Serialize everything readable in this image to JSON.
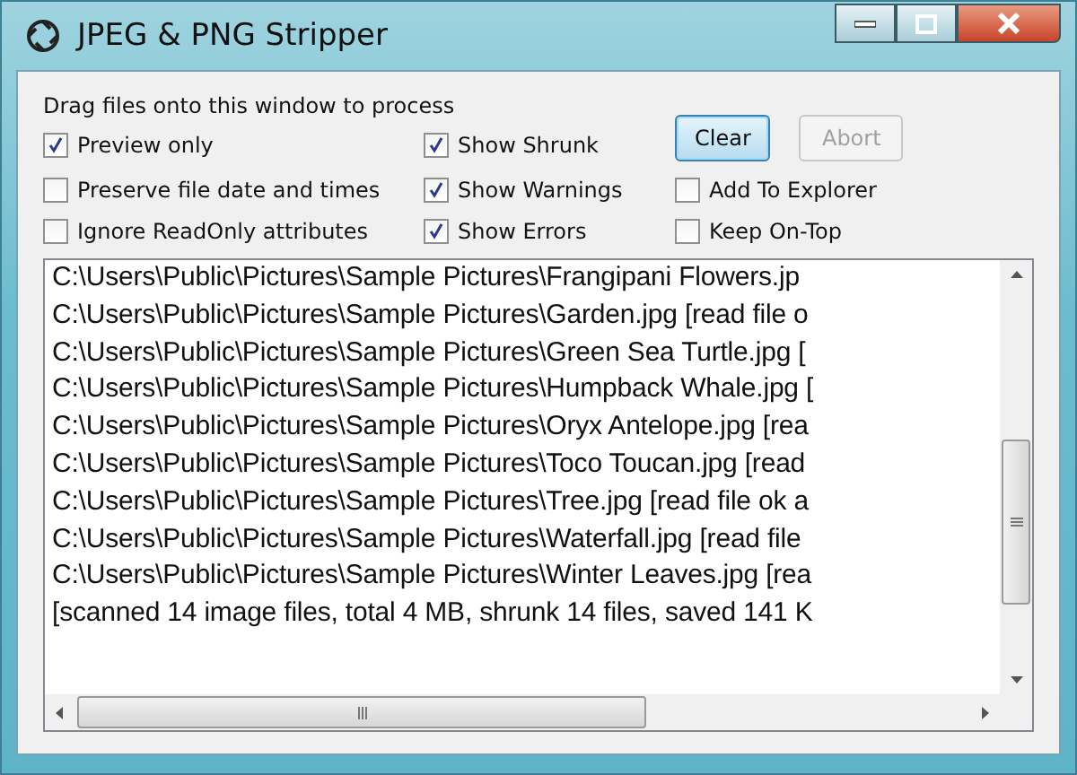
{
  "window": {
    "title": "JPEG & PNG Stripper"
  },
  "instruction": "Drag files onto this window to process",
  "options": [
    {
      "label": "Preview only",
      "checked": true
    },
    {
      "label": "Show Shrunk",
      "checked": true
    },
    {
      "label": "Preserve file date and times",
      "checked": false
    },
    {
      "label": "Show Warnings",
      "checked": true
    },
    {
      "label": "Add To Explorer",
      "checked": false
    },
    {
      "label": "Ignore ReadOnly attributes",
      "checked": false
    },
    {
      "label": "Show Errors",
      "checked": true
    },
    {
      "label": "Keep On-Top",
      "checked": false
    }
  ],
  "buttons": [
    {
      "label": "Clear",
      "disabled": false
    },
    {
      "label": "Abort",
      "disabled": true
    }
  ],
  "log": [
    "C:\\Users\\Public\\Pictures\\Sample Pictures\\Frangipani Flowers.jp",
    "C:\\Users\\Public\\Pictures\\Sample Pictures\\Garden.jpg [read file o",
    "C:\\Users\\Public\\Pictures\\Sample Pictures\\Green Sea Turtle.jpg [",
    "C:\\Users\\Public\\Pictures\\Sample Pictures\\Humpback Whale.jpg [",
    "C:\\Users\\Public\\Pictures\\Sample Pictures\\Oryx Antelope.jpg [rea",
    "C:\\Users\\Public\\Pictures\\Sample Pictures\\Toco Toucan.jpg [read",
    "C:\\Users\\Public\\Pictures\\Sample Pictures\\Tree.jpg [read file ok a",
    "C:\\Users\\Public\\Pictures\\Sample Pictures\\Waterfall.jpg [read file",
    "C:\\Users\\Public\\Pictures\\Sample Pictures\\Winter Leaves.jpg [rea",
    "[scanned 14 image files, total 4 MB, shrunk 14 files, saved 141 K"
  ]
}
